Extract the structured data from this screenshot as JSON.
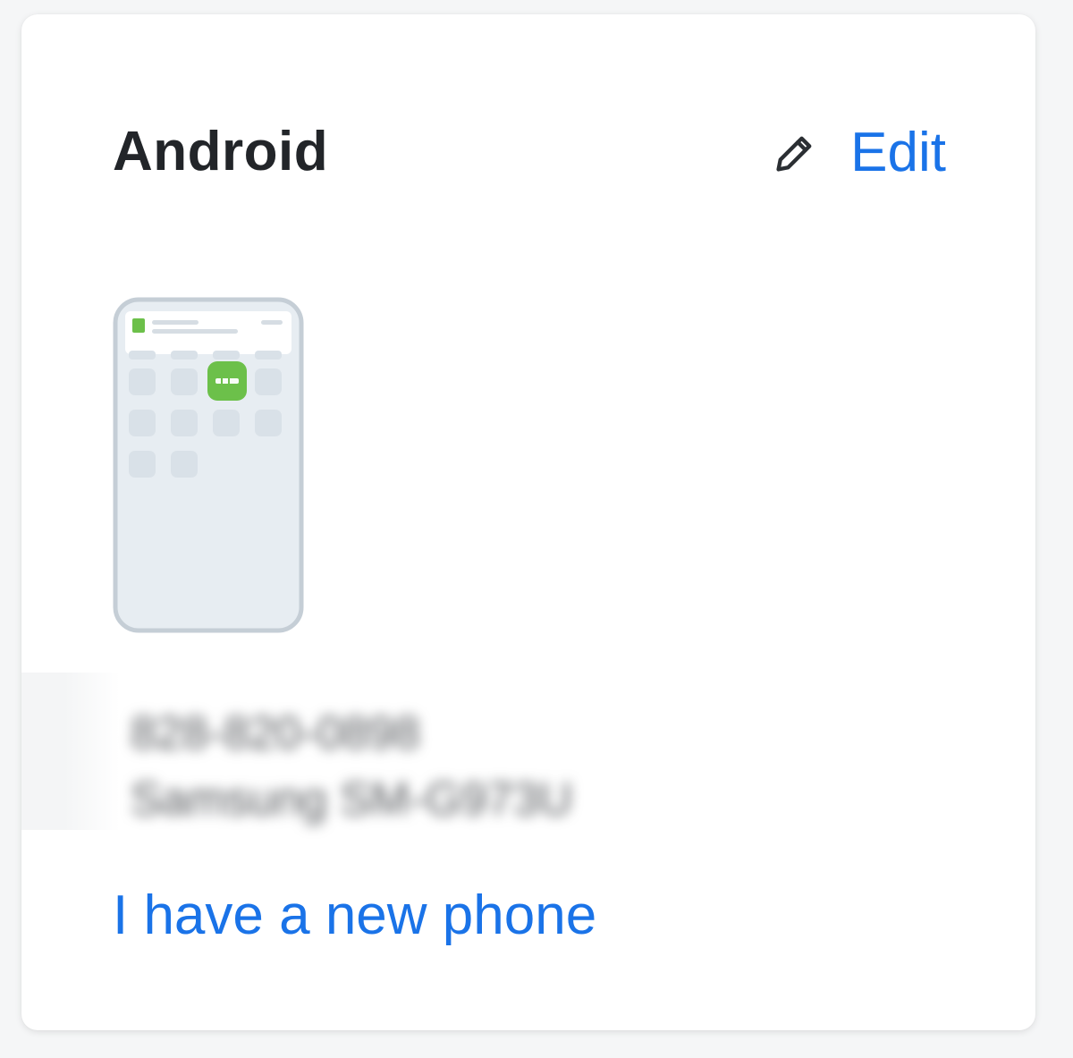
{
  "card": {
    "title": "Android",
    "edit_label": "Edit",
    "device_number": "828-820-0898",
    "device_model": "Samsung SM-G973U",
    "new_phone_link": "I have a new phone"
  },
  "icons": {
    "edit": "pencil-icon",
    "device": "phone-illustration",
    "app": "duo-app-icon"
  },
  "colors": {
    "link": "#1a73e8",
    "title": "#222529",
    "app_green": "#6cc04a"
  }
}
